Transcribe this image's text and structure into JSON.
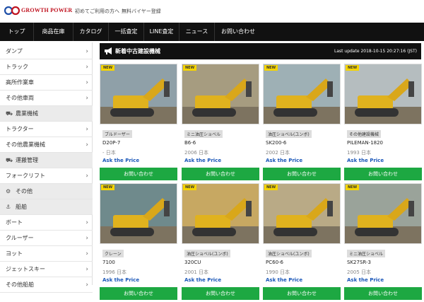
{
  "header": {
    "brand": "GROWTH POWER",
    "links": [
      "初めてご利用の方へ",
      "無料バイヤー登録"
    ]
  },
  "nav": [
    "トップ",
    "商品在庫",
    "カタログ",
    "一括査定",
    "LINE査定",
    "ニュース",
    "お問い合わせ"
  ],
  "sidebar": [
    {
      "label": "ダンプ",
      "chev": "›",
      "gray": false,
      "icon": ""
    },
    {
      "label": "トラック",
      "chev": "›",
      "gray": false,
      "icon": ""
    },
    {
      "label": "高所作業車",
      "chev": "›",
      "gray": false,
      "icon": ""
    },
    {
      "label": "その他車両",
      "chev": "›",
      "gray": false,
      "icon": ""
    },
    {
      "label": "農業機械",
      "chev": "",
      "gray": true,
      "icon": "tractor-icon"
    },
    {
      "label": "トラクター",
      "chev": "›",
      "gray": false,
      "icon": ""
    },
    {
      "label": "その他農業機械",
      "chev": "›",
      "gray": false,
      "icon": ""
    },
    {
      "label": "運搬管理",
      "chev": "",
      "gray": true,
      "icon": "truck-icon"
    },
    {
      "label": "フォークリフト",
      "chev": "›",
      "gray": false,
      "icon": ""
    },
    {
      "label": "その他",
      "chev": "",
      "gray": true,
      "icon": "gear-icon"
    },
    {
      "label": "船舶",
      "chev": "",
      "gray": true,
      "icon": "anchor-icon"
    },
    {
      "label": "ボート",
      "chev": "›",
      "gray": false,
      "icon": ""
    },
    {
      "label": "クルーザー",
      "chev": "›",
      "gray": false,
      "icon": ""
    },
    {
      "label": "ヨット",
      "chev": "›",
      "gray": false,
      "icon": ""
    },
    {
      "label": "ジェットスキー",
      "chev": "›",
      "gray": false,
      "icon": ""
    },
    {
      "label": "その他船舶",
      "chev": "›",
      "gray": false,
      "icon": ""
    }
  ],
  "section": {
    "title": "新着中古建設機械",
    "update": "Last update 2018-10-15 20:27:16 (JST)"
  },
  "cards": [
    {
      "badge": "NEW",
      "category": "ブルドーザー",
      "model": "D20P-7",
      "year": "-",
      "country": "日本",
      "price": "Ask the Price",
      "button": "お問い合わせ",
      "photo": "#8fa0a8"
    },
    {
      "badge": "NEW",
      "category": "ミニ油圧ショベル",
      "model": "B6-6",
      "year": "2006",
      "country": "日本",
      "price": "Ask the Price",
      "button": "お問い合わせ",
      "photo": "#a69c80"
    },
    {
      "badge": "NEW",
      "category": "油圧ショベル(ユンボ)",
      "model": "SK200-6",
      "year": "2002",
      "country": "日本",
      "price": "Ask the Price",
      "button": "お問い合わせ",
      "photo": "#9eb0b5"
    },
    {
      "badge": "NEW",
      "category": "その他建設機械",
      "model": "PILEMAN-1820",
      "year": "1993",
      "country": "日本",
      "price": "Ask the Price",
      "button": "お問い合わせ",
      "photo": "#b5bdbf"
    },
    {
      "badge": "NEW",
      "category": "クレーン",
      "model": "7100",
      "year": "1996",
      "country": "日本",
      "price": "Ask the Price",
      "button": "お問い合わせ",
      "photo": "#6f8a8c"
    },
    {
      "badge": "NEW",
      "category": "油圧ショベル(ユンボ)",
      "model": "320CU",
      "year": "2001",
      "country": "日本",
      "price": "Ask the Price",
      "button": "お問い合わせ",
      "photo": "#c7a862"
    },
    {
      "badge": "NEW",
      "category": "油圧ショベル(ユンボ)",
      "model": "PC60-6",
      "year": "1990",
      "country": "日本",
      "price": "Ask the Price",
      "button": "お問い合わせ",
      "photo": "#b9aa86"
    },
    {
      "badge": "NEW",
      "category": "ミニ油圧ショベル",
      "model": "SK27SR-3",
      "year": "2005",
      "country": "日本",
      "price": "Ask the Price",
      "button": "お問い合わせ",
      "photo": "#9aa39a"
    }
  ]
}
